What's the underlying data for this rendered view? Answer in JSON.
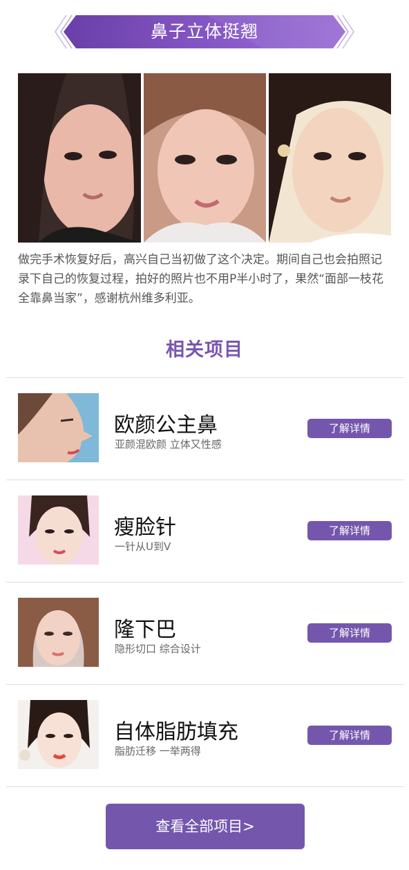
{
  "banner": {
    "title": "鼻子立体挺翘"
  },
  "testimonial": {
    "text": "做完手术恢复好后，高兴自己当初做了这个决定。期间自己也会拍照记录下自己的恢复过程，拍好的照片也不用P半小时了，果然“面部一枝花全靠鼻当家”，感谢杭州维多利亚。"
  },
  "related": {
    "heading": "相关项目",
    "items": [
      {
        "title": "欧颜公主鼻",
        "subtitle": "亚颜混欧颜 立体又性感",
        "button": "了解详情"
      },
      {
        "title": "瘦脸针",
        "subtitle": "一针从U到V",
        "button": "了解详情"
      },
      {
        "title": "隆下巴",
        "subtitle": "隐形切口 综合设计",
        "button": "了解详情"
      },
      {
        "title": "自体脂肪填充",
        "subtitle": "脂肪迁移 一举两得",
        "button": "了解详情"
      }
    ]
  },
  "view_all": {
    "label": "查看全部项目>"
  },
  "colors": {
    "accent": "#7457ad",
    "heading": "#7a55b0"
  }
}
